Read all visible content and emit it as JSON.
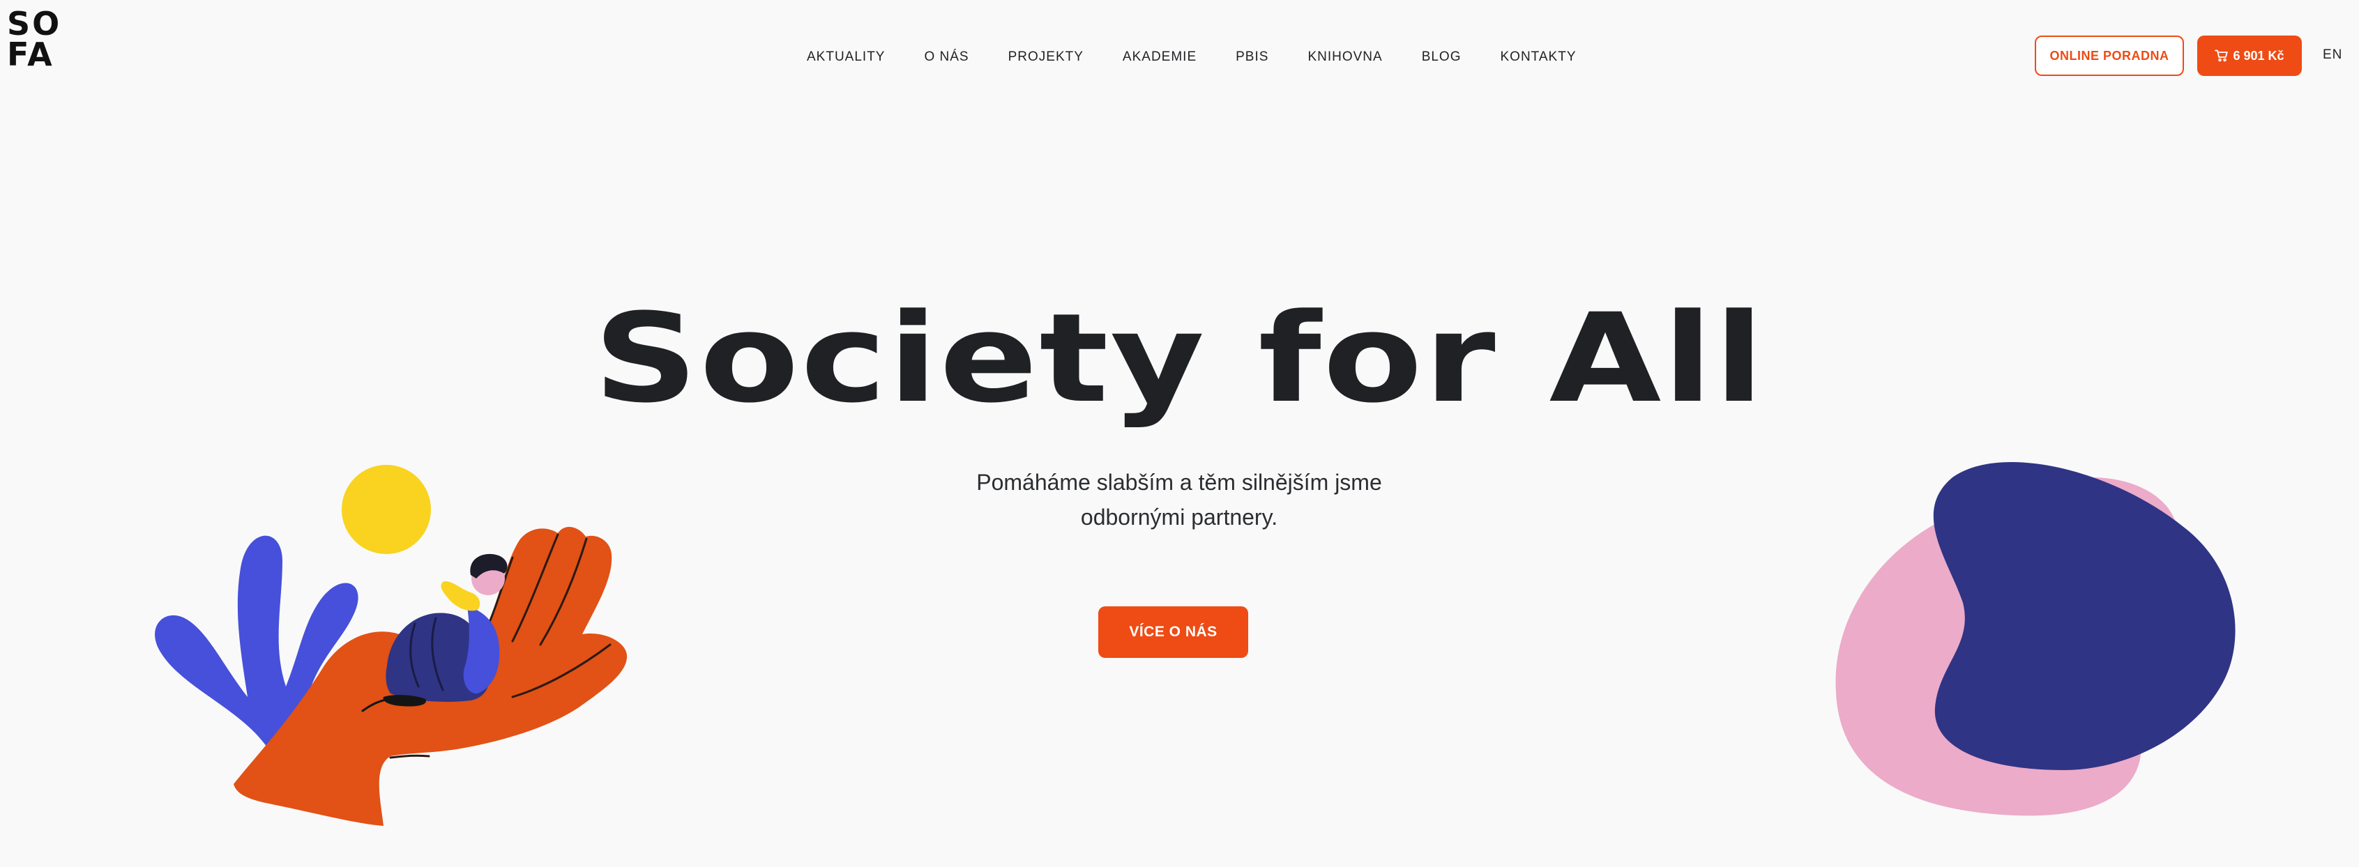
{
  "logo": {
    "line1": "SO",
    "line2": "FA"
  },
  "nav": {
    "items": [
      {
        "label": "AKTUALITY"
      },
      {
        "label": "O NÁS"
      },
      {
        "label": "PROJEKTY"
      },
      {
        "label": "AKADEMIE"
      },
      {
        "label": "PBIS"
      },
      {
        "label": "KNIHOVNA"
      },
      {
        "label": "BLOG"
      },
      {
        "label": "KONTAKTY"
      }
    ]
  },
  "header": {
    "online_label": "ONLINE PORADNA",
    "cart_label": "6 901 Kč",
    "cart_icon": "cart-icon",
    "lang_label": "EN"
  },
  "hero": {
    "title": "Society for All",
    "subtitle_line1": "Pomáháme slabším a těm silnějším jsme",
    "subtitle_line2": "odbornými partnery.",
    "button_label": "VÍCE O NÁS"
  },
  "colors": {
    "accent": "#ef4b14",
    "text": "#1f2124",
    "background": "#f9f9f9",
    "yellow": "#f9d31f",
    "blue": "#4650db",
    "navy": "#2f3485",
    "pink": "#ecabc8",
    "hand_orange": "#e25115"
  }
}
